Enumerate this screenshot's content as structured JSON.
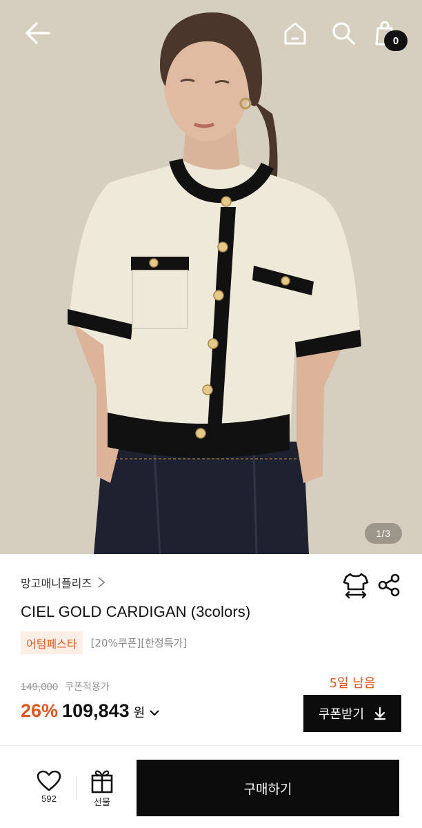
{
  "header": {
    "back_icon": "arrow-left-icon",
    "home_icon": "home-icon",
    "search_icon": "search-icon",
    "cart_icon": "shopping-bag-icon",
    "cart_count": "0"
  },
  "gallery": {
    "image": "product-photo",
    "pager": "1/3"
  },
  "product": {
    "brand": "망고매니플리즈",
    "brand_chevron_icon": "chevron-right-icon",
    "size_icon": "size-guide-shirt-icon",
    "share_icon": "share-icon",
    "title": "CIEL GOLD CARDIGAN (3colors)",
    "festival_tag": "어텀페스타",
    "tag_note": "[20%쿠폰][한정특가]",
    "original_price": "149,000",
    "coupon_note": "쿠폰적용가",
    "discount": "26%",
    "price": "109,843",
    "currency": "원",
    "price_chevron_icon": "chevron-down-icon",
    "days_left": "5일 남음",
    "coupon_button": "쿠폰받기",
    "coupon_icon": "download-icon"
  },
  "bottom_bar": {
    "like_icon": "heart-icon",
    "like_count": "592",
    "gift_icon": "gift-icon",
    "gift_label": "선물",
    "buy_button": "구매하기"
  },
  "colors": {
    "accent": "#e2571f",
    "accent_bg": "#fdeee6",
    "button_dark": "#0c0c0c"
  }
}
